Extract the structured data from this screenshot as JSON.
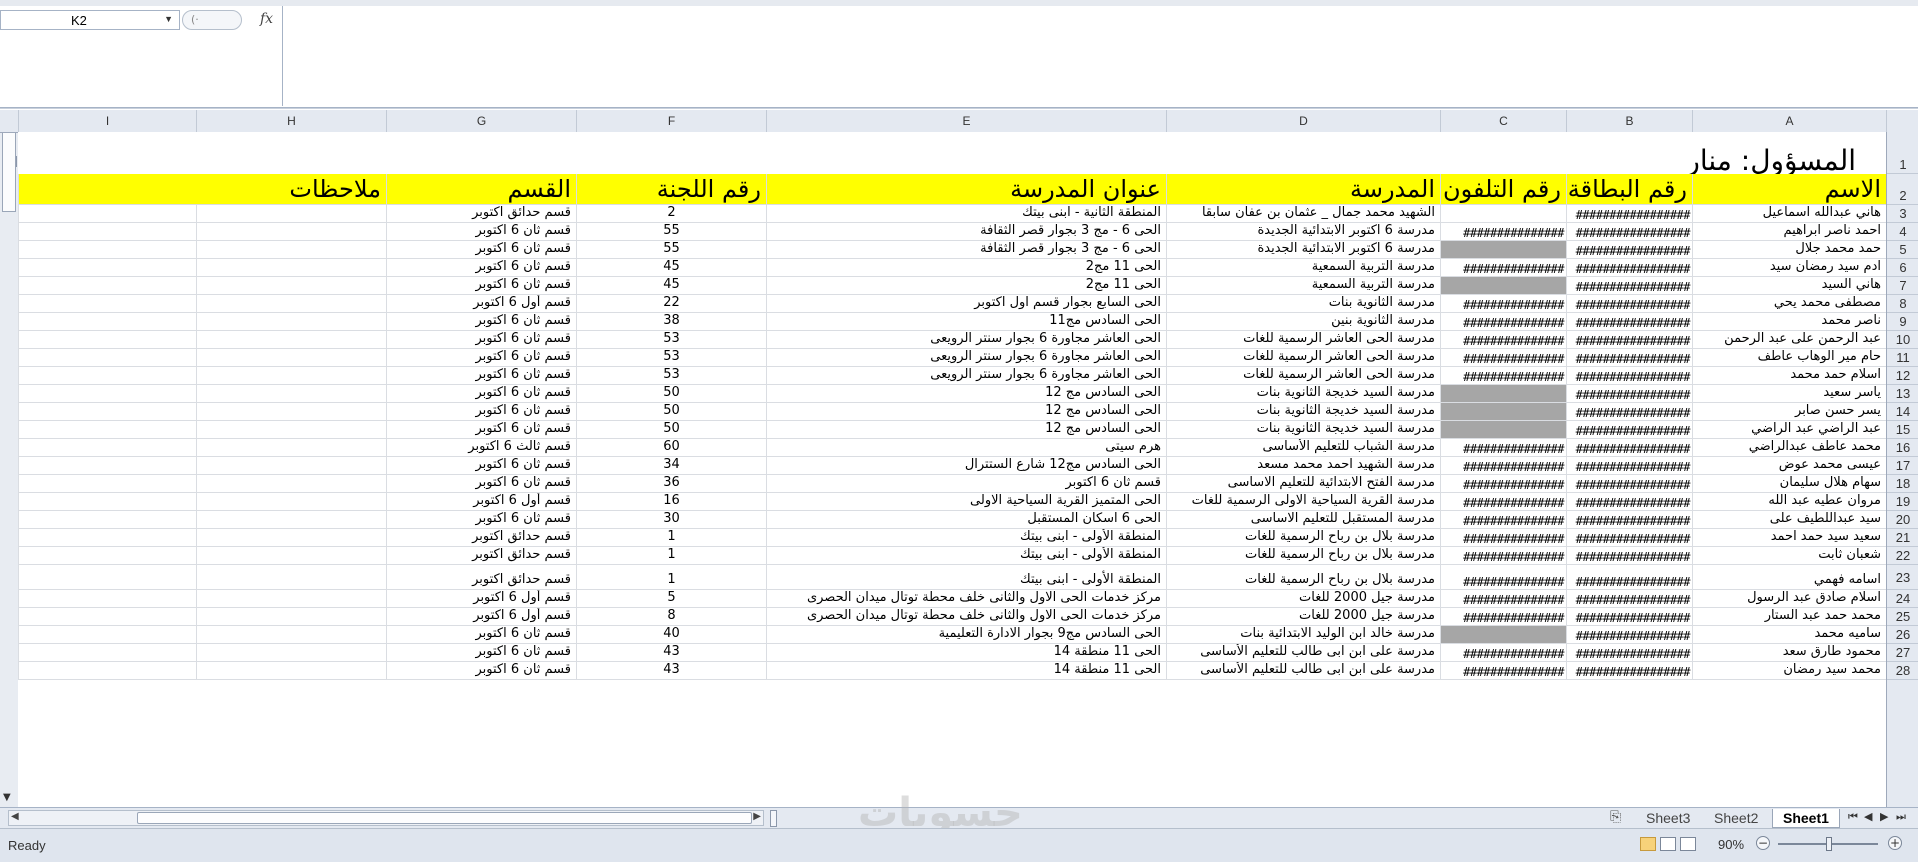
{
  "formula_bar": {
    "name_box": "K2",
    "fx_label": "fx",
    "formula": ""
  },
  "columns": [
    "I",
    "H",
    "G",
    "F",
    "E",
    "D",
    "C",
    "B",
    "A"
  ],
  "sheet": {
    "title": "المسؤول: منار",
    "headers": [
      "ملاحظات",
      "القسم",
      "رقم اللجنة",
      "عنوان المدرسة",
      "المدرسة",
      "رقم التلفون",
      "رقم البطاقة",
      "الاسم"
    ],
    "rows": [
      {
        "n": "3",
        "A": "هاني عبدالله اسماعيل",
        "B": "#################",
        "C": "",
        "Cg": false,
        "D": "الشهيد محمد جمال _ عثمان بن عفان سابقا",
        "E": "المنطقة الثانية - ابنى بيتك",
        "F": "2",
        "G": "قسم حدائق اكتوبر"
      },
      {
        "n": "4",
        "A": "احمد ناصر ابراهيم",
        "B": "#################",
        "C": "###############",
        "Cg": false,
        "D": "مدرسة 6 اكتوبر الابتدائية الجديدة",
        "E": "الحى 6 - مج 3 بجوار قصر الثقافة",
        "F": "55",
        "G": "قسم ثان 6 اكتوبر"
      },
      {
        "n": "5",
        "A": "حمد محمد جلال",
        "B": "#################",
        "C": "",
        "Cg": true,
        "D": "مدرسة 6 اكتوبر الابتدائية الجديدة",
        "E": "الحى 6 - مج 3 بجوار قصر الثقافة",
        "F": "55",
        "G": "قسم ثان 6 اكتوبر"
      },
      {
        "n": "6",
        "A": "ادم سيد رمضان سيد",
        "B": "#################",
        "C": "###############",
        "Cg": false,
        "D": "مدرسة التربية السمعية",
        "E": "الحى 11 مج2",
        "F": "45",
        "G": "قسم ثان 6 اكتوبر"
      },
      {
        "n": "7",
        "A": "هاني السيد",
        "B": "#################",
        "C": "",
        "Cg": true,
        "D": "مدرسة التربية السمعية",
        "E": "الحى 11 مج2",
        "F": "45",
        "G": "قسم ثان 6 اكتوبر"
      },
      {
        "n": "8",
        "A": "مصطفى محمد يحي",
        "B": "#################",
        "C": "###############",
        "Cg": false,
        "D": "مدرسة الثانوية بنات",
        "E": "الحى السابع بجوار قسم اول اكتوبر",
        "F": "22",
        "G": "قسم أول 6 اكتوبر"
      },
      {
        "n": "9",
        "A": "ناصر محمد",
        "B": "#################",
        "C": "###############",
        "Cg": false,
        "D": "مدرسة الثانوية بنين",
        "E": "الحى السادس مج11",
        "F": "38",
        "G": "قسم ثان 6 اكتوبر"
      },
      {
        "n": "10",
        "A": "عبد الرحمن على عبد الرحمن",
        "B": "#################",
        "C": "###############",
        "Cg": false,
        "D": "مدرسة الحى العاشر الرسمية للغات",
        "E": "الحى العاشر مجاورة 6 بجوار سنتر الرويعى",
        "F": "53",
        "G": "قسم ثان 6 اكتوبر"
      },
      {
        "n": "11",
        "A": "حام مير الوهاب عاطف",
        "B": "#################",
        "C": "###############",
        "Cg": false,
        "D": "مدرسة الحى العاشر الرسمية للغات",
        "E": "الحى العاشر مجاورة 6 بجوار سنتر الرويعى",
        "F": "53",
        "G": "قسم ثان 6 اكتوبر"
      },
      {
        "n": "12",
        "A": "اسلام حمد محمد",
        "B": "#################",
        "C": "###############",
        "Cg": false,
        "D": "مدرسة الحى العاشر الرسمية للغات",
        "E": "الحى العاشر مجاورة 6 بجوار سنتر الرويعى",
        "F": "53",
        "G": "قسم ثان 6 اكتوبر"
      },
      {
        "n": "13",
        "A": "ياسر سعيد",
        "B": "#################",
        "C": "",
        "Cg": true,
        "D": "مدرسة السيد خديجة الثانوية بنات",
        "E": "الحى السادس مج 12",
        "F": "50",
        "G": "قسم ثان 6 اكتوبر"
      },
      {
        "n": "14",
        "A": "يسر حسن صابر",
        "B": "#################",
        "C": "",
        "Cg": true,
        "D": "مدرسة السيد خديجة الثانوية بنات",
        "E": "الحى السادس مج 12",
        "F": "50",
        "G": "قسم ثان 6 اكتوبر"
      },
      {
        "n": "15",
        "A": "عبد الراضي عبد الراضي",
        "B": "#################",
        "C": "",
        "Cg": true,
        "D": "مدرسة السيد خديجة الثانوية بنات",
        "E": "الحى السادس مج 12",
        "F": "50",
        "G": "قسم ثان 6 اكتوبر"
      },
      {
        "n": "16",
        "A": "محمد عاطف عبدالراضي",
        "B": "#################",
        "C": "###############",
        "Cg": false,
        "D": "مدرسة الشباب للتعليم الأساسى",
        "E": "هرم سيتى",
        "F": "60",
        "G": "قسم ثالث 6 اكتوبر"
      },
      {
        "n": "17",
        "A": "عيسى محمد عوض",
        "B": "#################",
        "C": "###############",
        "Cg": false,
        "D": "مدرسة الشهيد احمد محمد مسعد",
        "E": "الحى السادس مج12 شارع الستترال",
        "F": "34",
        "G": "قسم ثان 6 اكتوبر"
      },
      {
        "n": "18",
        "A": "سهام هلال سليمان",
        "B": "#################",
        "C": "###############",
        "Cg": false,
        "D": "مدرسة الفتح الابتدائية للتعليم الاساسى",
        "E": "قسم ثان 6 اكتوبر",
        "F": "36",
        "G": "قسم ثان 6 اكتوبر"
      },
      {
        "n": "19",
        "A": "مروان عطيه عبد الله",
        "B": "#################",
        "C": "###############",
        "Cg": false,
        "D": "مدرسة القرية السياحية الاولى الرسمية للغات",
        "E": "الحى المتميز القرية السياحية الاولى",
        "F": "16",
        "G": "قسم أول 6 اكتوبر"
      },
      {
        "n": "20",
        "A": "سيد عبداللطيف على",
        "B": "#################",
        "C": "###############",
        "Cg": false,
        "D": "مدرسة المستقبل للتعليم الاساسى",
        "E": "الحى 6 اسكان المستقبل",
        "F": "30",
        "G": "قسم ثان 6 اكتوبر"
      },
      {
        "n": "21",
        "A": "سعيد سيد حمد احمد",
        "B": "#################",
        "C": "###############",
        "Cg": false,
        "D": "مدرسة بلال بن رباح الرسمية للغات",
        "E": "المنطقة الأولى - ابنى بيتك",
        "F": "1",
        "G": "قسم حدائق اكتوبر"
      },
      {
        "n": "22",
        "A": "شعبان ثابت",
        "B": "#################",
        "C": "###############",
        "Cg": false,
        "D": "مدرسة بلال بن رباح الرسمية للغات",
        "E": "المنطقة الأولى - ابنى بيتك",
        "F": "1",
        "G": "قسم حدائق اكتوبر"
      },
      {
        "n": "23",
        "A": "اسامه فهمي",
        "B": "#################",
        "C": "###############",
        "Cg": false,
        "D": "مدرسة بلال بن رباح الرسمية للغات",
        "E": "المنطقة الأولى - ابنى بيتك",
        "F": "1",
        "G": "قسم حدائق اكتوبر"
      },
      {
        "n": "24",
        "A": "اسلام صادق عبد الرسول",
        "B": "#################",
        "C": "###############",
        "Cg": false,
        "D": "مدرسة جيل 2000 للغات",
        "E": "مركز خدمات الحى الاول والثانى خلف محطة توتال ميدان الحصرى",
        "F": "5",
        "G": "قسم أول 6 اكتوبر"
      },
      {
        "n": "25",
        "A": "محمد حمد عبد الستار",
        "B": "#################",
        "C": "###############",
        "Cg": false,
        "D": "مدرسة جيل 2000 للغات",
        "E": "مركز خدمات الحى الاول والثانى خلف محطة توتال ميدان الحصرى",
        "F": "8",
        "G": "قسم أول 6 اكتوبر"
      },
      {
        "n": "26",
        "A": "ساميه محمد",
        "B": "#################",
        "C": "",
        "Cg": true,
        "D": "مدرسة خالد ابن الوليد الابتدائية بنات",
        "E": "الحى السادس مج9 بجوار الادارة التعليمية",
        "F": "40",
        "G": "قسم ثان 6 اكتوبر"
      },
      {
        "n": "27",
        "A": "محمود طارق سعد",
        "B": "#################",
        "C": "###############",
        "Cg": false,
        "D": "مدرسة على ابن ابى طالب للتعليم الأساسى",
        "E": "الحى 11 منطقة 14",
        "F": "43",
        "G": "قسم ثان 6 اكتوبر"
      },
      {
        "n": "28",
        "A": "محمد سيد رمضان",
        "B": "#################",
        "C": "###############",
        "Cg": false,
        "D": "مدرسة على ابن ابى طالب للتعليم الأساسى",
        "E": "الحى 11 منطقة 14",
        "F": "43",
        "G": "قسم ثان 6 اكتوبر"
      }
    ]
  },
  "tabs": [
    "Sheet3",
    "Sheet2",
    "Sheet1"
  ],
  "active_tab": "Sheet1",
  "status": {
    "ready": "Ready",
    "zoom": "90%"
  },
  "watermark": "حسوبات"
}
